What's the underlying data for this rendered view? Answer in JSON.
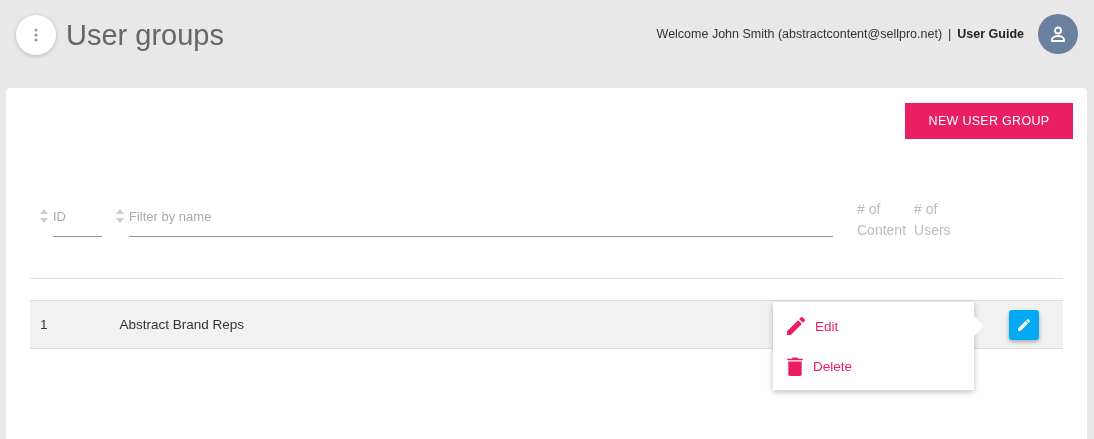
{
  "header": {
    "title": "User groups",
    "welcome": "Welcome John Smith (abstractcontent@sellpro.net)",
    "separator": "|",
    "user_guide": "User Guide"
  },
  "new_button": "NEW USER GROUP",
  "columns": [
    {
      "kind": "filter",
      "placeholder": "ID"
    },
    {
      "kind": "filter",
      "placeholder": "Filter by name"
    },
    {
      "kind": "label",
      "lines": [
        "# of",
        "Content"
      ]
    },
    {
      "kind": "label",
      "lines": [
        "# of",
        "Users"
      ]
    }
  ],
  "rows": [
    {
      "id": "1",
      "name": "Abstract Brand Reps"
    }
  ],
  "menu": [
    {
      "kind": "edit",
      "label": "Edit"
    },
    {
      "kind": "delete",
      "label": "Delete"
    }
  ]
}
